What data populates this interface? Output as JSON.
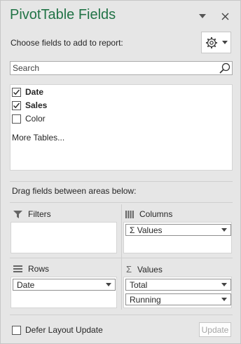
{
  "pane": {
    "title": "PivotTable Fields",
    "choose_label": "Choose fields to add to report:",
    "accent_color": "#217346"
  },
  "header_buttons": {
    "dropdown_icon": "chevron-down-icon",
    "close_icon": "close-icon"
  },
  "tools": {
    "icon": "gear-icon"
  },
  "search": {
    "placeholder": "Search",
    "value": "",
    "icon": "search-icon"
  },
  "fields": [
    {
      "label": "Date",
      "checked": true,
      "bold": true
    },
    {
      "label": "Sales",
      "checked": true,
      "bold": true
    },
    {
      "label": "Color",
      "checked": false,
      "bold": false
    }
  ],
  "more_tables": "More Tables...",
  "drag_label": "Drag fields between areas below:",
  "areas": {
    "filters": {
      "label": "Filters",
      "icon": "filter-icon",
      "items": []
    },
    "columns": {
      "label": "Columns",
      "icon": "columns-icon",
      "items": [
        "Σ Values"
      ]
    },
    "rows": {
      "label": "Rows",
      "icon": "rows-icon",
      "items": [
        "Date"
      ]
    },
    "values": {
      "label": "Values",
      "icon": "sigma-icon",
      "items": [
        "Total",
        "Running"
      ]
    }
  },
  "footer": {
    "defer_label": "Defer Layout Update",
    "defer_checked": false,
    "update_label": "Update",
    "update_enabled": false
  }
}
